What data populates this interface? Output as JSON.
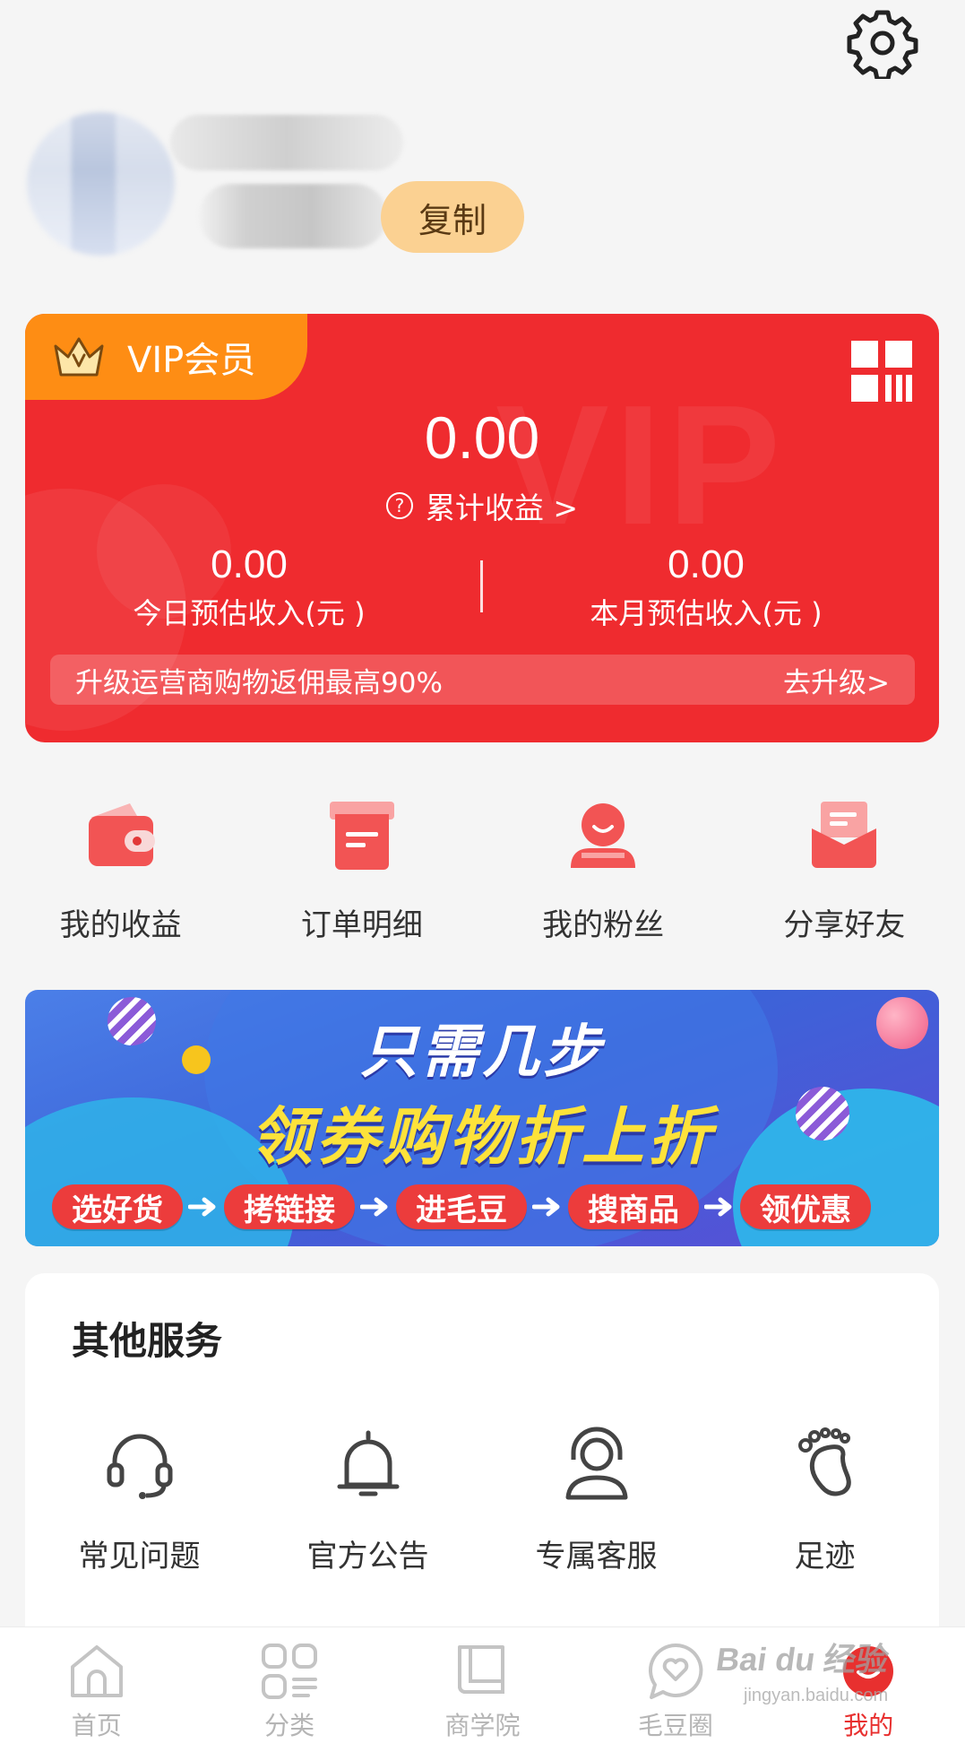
{
  "header": {
    "copy_label": "复制"
  },
  "vip_card": {
    "badge_label": "VIP会员",
    "watermark": "VIP",
    "total_amount": "0.00",
    "total_label": "累计收益 >",
    "today": {
      "amount": "0.00",
      "label": "今日预估收入(元 )"
    },
    "month": {
      "amount": "0.00",
      "label": "本月预估收入(元 )"
    },
    "upgrade_text": "升级运营商购物返佣最高90%",
    "upgrade_link": "去升级>",
    "colors": {
      "card": "#ef2b2f",
      "badge": "#fe8d14"
    }
  },
  "quick_menu": [
    {
      "label": "我的收益",
      "icon": "wallet-icon"
    },
    {
      "label": "订单明细",
      "icon": "order-icon"
    },
    {
      "label": "我的粉丝",
      "icon": "fans-icon"
    },
    {
      "label": "分享好友",
      "icon": "share-icon"
    }
  ],
  "banner": {
    "title": "只需几步",
    "subtitle": "领券购物折上折",
    "steps": [
      "选好货",
      "拷链接",
      "进毛豆",
      "搜商品",
      "领优惠"
    ]
  },
  "services": {
    "title": "其他服务",
    "items": [
      {
        "label": "常见问题",
        "icon": "headset-icon"
      },
      {
        "label": "官方公告",
        "icon": "bell-icon"
      },
      {
        "label": "专属客服",
        "icon": "customer-service-icon"
      },
      {
        "label": "足迹",
        "icon": "footprint-icon"
      }
    ]
  },
  "tabbar": {
    "items": [
      {
        "label": "首页",
        "icon": "home-icon"
      },
      {
        "label": "分类",
        "icon": "category-icon"
      },
      {
        "label": "商学院",
        "icon": "book-icon"
      },
      {
        "label": "毛豆圈",
        "icon": "heart-chat-icon"
      },
      {
        "label": "我的",
        "icon": "profile-icon"
      }
    ],
    "active_color": "#e8302f"
  },
  "watermark": {
    "text": "Bai du 经验",
    "url": "jingyan.baidu.com"
  }
}
